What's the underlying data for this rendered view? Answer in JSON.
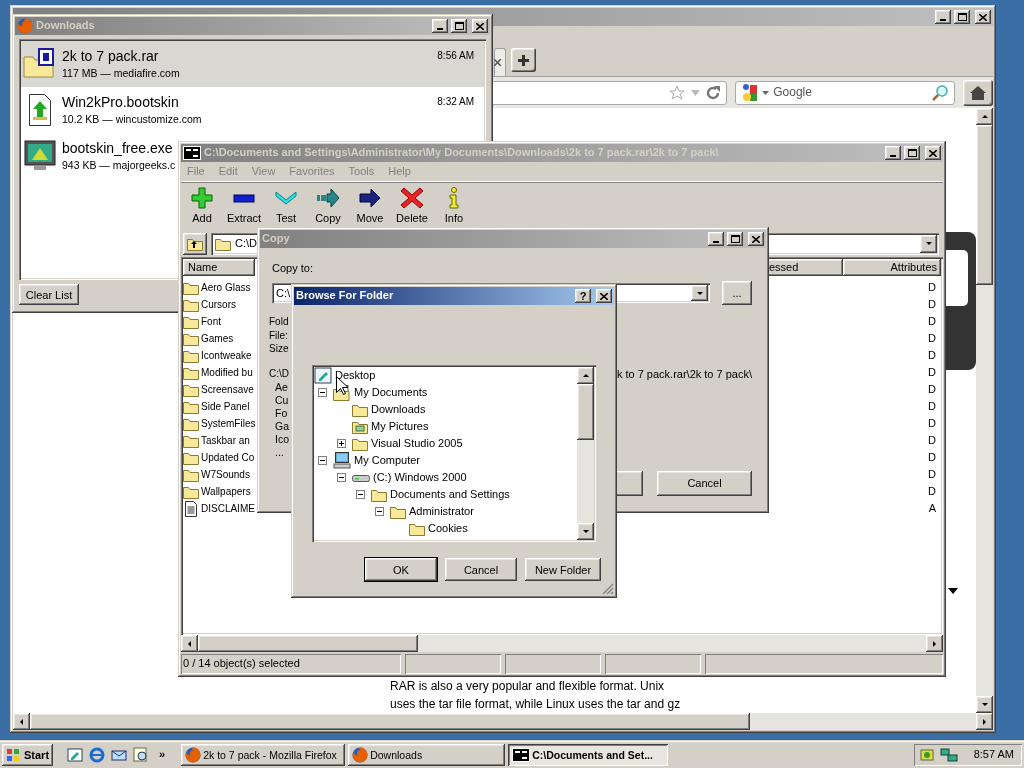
{
  "firefox": {
    "active": false,
    "search_placeholder": "Google",
    "page_text": [
      "RAR is also a very popular and flexible format. Unix",
      "uses the tar file format, while Linux uses the tar and gz"
    ]
  },
  "downloads": {
    "title": "Downloads",
    "active": false,
    "items": [
      {
        "name": "2k to 7 pack.rar",
        "detail": "117 MB — mediafire.com",
        "time": "8:56 AM",
        "kind": "rar",
        "selected": true
      },
      {
        "name": "Win2kPro.bootskin",
        "detail": "10.2 KB — wincustomize.com",
        "time": "8:32 AM",
        "kind": "skin",
        "selected": false
      },
      {
        "name": "bootskin_free.exe",
        "detail": "943 KB — majorgeeks.c",
        "kind": "exe",
        "selected": false
      }
    ],
    "clear_button": "Clear List"
  },
  "sevenzip": {
    "title": "C:\\Documents and Settings\\Administrator\\My Documents\\Downloads\\2k to 7 pack.rar\\2k to 7 pack\\",
    "active": false,
    "menu": [
      "File",
      "Edit",
      "View",
      "Favorites",
      "Tools",
      "Help"
    ],
    "toolbar": [
      {
        "label": "Add",
        "kind": "add"
      },
      {
        "label": "Extract",
        "kind": "extract"
      },
      {
        "label": "Test",
        "kind": "test"
      },
      {
        "label": "Copy",
        "kind": "copy"
      },
      {
        "label": "Move",
        "kind": "move"
      },
      {
        "label": "Delete",
        "kind": "delete"
      },
      {
        "label": "Info",
        "kind": "info"
      }
    ],
    "path": "C:\\D",
    "columns": [
      "Name",
      "essed",
      "Attributes"
    ],
    "rows": [
      {
        "name": "Aero Glass",
        "kind": "folder",
        "attributes": "D"
      },
      {
        "name": "Cursors",
        "kind": "folder",
        "attributes": "D"
      },
      {
        "name": "Font",
        "kind": "folder",
        "attributes": "D"
      },
      {
        "name": "Games",
        "kind": "folder",
        "attributes": "D"
      },
      {
        "name": "Icontweake",
        "kind": "folder",
        "attributes": "D"
      },
      {
        "name": "Modified bu",
        "kind": "folder",
        "attributes": "D"
      },
      {
        "name": "Screensave",
        "kind": "folder",
        "attributes": "D"
      },
      {
        "name": "Side Panel",
        "kind": "folder",
        "attributes": "D"
      },
      {
        "name": "SystemFiles",
        "kind": "folder",
        "attributes": "D"
      },
      {
        "name": "Taskbar an",
        "kind": "folder",
        "attributes": "D"
      },
      {
        "name": "Updated Co",
        "kind": "folder",
        "attributes": "D"
      },
      {
        "name": "W7Sounds",
        "kind": "folder",
        "attributes": "D"
      },
      {
        "name": "Wallpapers",
        "kind": "folder",
        "attributes": "D"
      },
      {
        "name": "DISCLAIME",
        "kind": "file",
        "attributes": "A"
      }
    ],
    "status": "0 / 14 object(s) selected"
  },
  "copy_dialog": {
    "title": "Copy",
    "active": false,
    "label": "Copy to:",
    "value": "C:\\",
    "browse_button": "...",
    "info_labels": [
      "Fold",
      "File:",
      "Size"
    ],
    "path_start": "C:\\D",
    "path_end": "k to 7 pack.rar\\2k to 7 pack\\",
    "listing": [
      "Ae",
      "Cu",
      "Fo",
      "Ga",
      "Ico",
      "..."
    ],
    "cancel_button": "Cancel"
  },
  "browse_dialog": {
    "title": "Browse For Folder",
    "active": true,
    "help_button": "?",
    "tree": [
      {
        "label": "Desktop",
        "kind": "desktop",
        "children": [
          {
            "label": "My Documents",
            "kind": "mydocs",
            "expanded": true,
            "children": [
              {
                "label": "Downloads",
                "kind": "folder"
              },
              {
                "label": "My Pictures",
                "kind": "pictures"
              },
              {
                "label": "Visual Studio 2005",
                "kind": "folder",
                "expanded": false
              }
            ]
          },
          {
            "label": "My Computer",
            "kind": "computer",
            "expanded": true,
            "children": [
              {
                "label": "(C:) Windows 2000",
                "kind": "drive",
                "expanded": true,
                "children": [
                  {
                    "label": "Documents and Settings",
                    "kind": "folder",
                    "expanded": true,
                    "children": [
                      {
                        "label": "Administrator",
                        "kind": "folder",
                        "expanded": true,
                        "children": [
                          {
                            "label": "Cookies",
                            "kind": "folder"
                          }
                        ]
                      }
                    ]
                  }
                ]
              }
            ]
          }
        ]
      }
    ],
    "buttons": [
      "OK",
      "Cancel",
      "New Folder"
    ]
  },
  "taskbar": {
    "start": "Start",
    "more": "»",
    "tasks": [
      {
        "label": "2k to 7 pack - Mozilla Firefox",
        "kind": "firefox",
        "selected": false
      },
      {
        "label": "Downloads",
        "kind": "firefox",
        "selected": false
      },
      {
        "label": "C:\\Documents and Set...",
        "kind": "sevenzip",
        "selected": true
      }
    ],
    "clock": "8:57 AM"
  }
}
